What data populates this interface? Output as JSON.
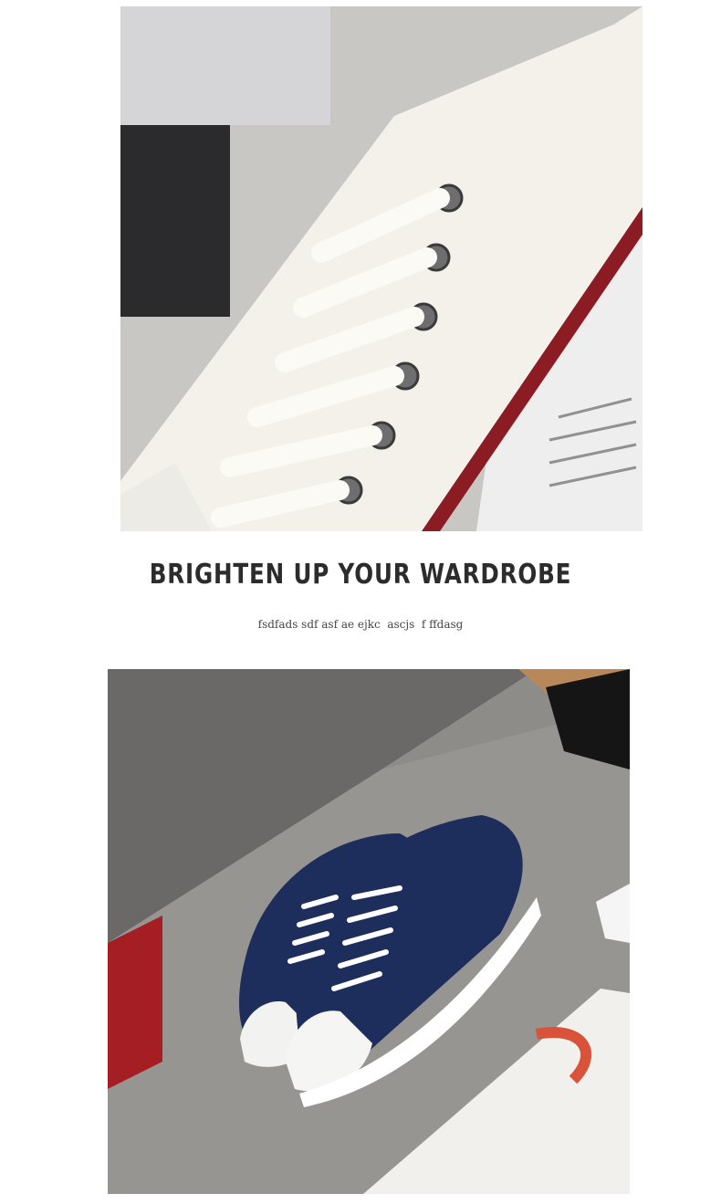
{
  "hero": {
    "top_image_alt": "White canvas sneaker close-up",
    "bottom_image_alt": "Navy canvas sneakers on concrete"
  },
  "promo": {
    "headline": "BRIGHTEN UP YOUR WARDROBE",
    "subtitle": "fsdfads sdf asf ae ejkc  ascjs  f ffdasg"
  },
  "colors": {
    "canvas_white": "#f3f1ea",
    "sole_red": "#8b1c24",
    "canvas_navy": "#1d2d5c",
    "concrete": "#8e8c88"
  }
}
